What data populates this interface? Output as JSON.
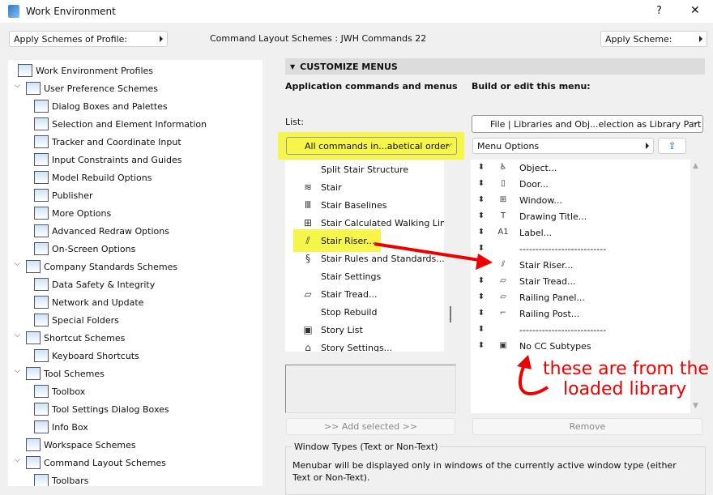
{
  "window": {
    "title": "Work Environment",
    "help": "?",
    "close": "✕"
  },
  "top": {
    "apply_profile": "Apply Schemes of Profile:",
    "layout_label": "Command Layout Schemes :",
    "layout_value": "JWH Commands 22",
    "apply_scheme": "Apply Scheme:"
  },
  "tree": [
    {
      "label": "Work Environment Profiles",
      "level": 0,
      "toggle": false
    },
    {
      "label": "User Preference Schemes",
      "level": 1,
      "toggle": true
    },
    {
      "label": "Dialog Boxes and Palettes",
      "level": 2
    },
    {
      "label": "Selection and Element Information",
      "level": 2
    },
    {
      "label": "Tracker and Coordinate Input",
      "level": 2
    },
    {
      "label": "Input Constraints and Guides",
      "level": 2
    },
    {
      "label": "Model Rebuild Options",
      "level": 2
    },
    {
      "label": "Publisher",
      "level": 2
    },
    {
      "label": "More Options",
      "level": 2
    },
    {
      "label": "Advanced Redraw Options",
      "level": 2
    },
    {
      "label": "On-Screen Options",
      "level": 2
    },
    {
      "label": "Company Standards Schemes",
      "level": 1,
      "toggle": true
    },
    {
      "label": "Data Safety & Integrity",
      "level": 2
    },
    {
      "label": "Network and Update",
      "level": 2
    },
    {
      "label": "Special Folders",
      "level": 2
    },
    {
      "label": "Shortcut Schemes",
      "level": 1,
      "toggle": true
    },
    {
      "label": "Keyboard Shortcuts",
      "level": 2
    },
    {
      "label": "Tool Schemes",
      "level": 1,
      "toggle": true
    },
    {
      "label": "Toolbox",
      "level": 2
    },
    {
      "label": "Tool Settings Dialog Boxes",
      "level": 2
    },
    {
      "label": "Info Box",
      "level": 2
    },
    {
      "label": "Workspace Schemes",
      "level": 1,
      "toggle": false
    },
    {
      "label": "Command Layout Schemes",
      "level": 1,
      "toggle": true
    },
    {
      "label": "Toolbars",
      "level": 2
    }
  ],
  "section": {
    "title": "CUSTOMIZE MENUS",
    "left_heading": "Application commands and menus",
    "right_heading": "Build or edit this menu:",
    "list_label": "List:"
  },
  "list_filter": "All commands in...abetical order",
  "commands": [
    {
      "label": "Split Stair Structure",
      "icon": ""
    },
    {
      "label": "Stair",
      "icon": "stair-icon"
    },
    {
      "label": "Stair Baselines",
      "icon": "stair-baselines-icon"
    },
    {
      "label": "Stair Calculated Walking Line",
      "icon": "walking-line-icon"
    },
    {
      "label": "Stair Riser...",
      "icon": "stair-riser-icon",
      "highlight": true
    },
    {
      "label": "Stair Rules and Standards...",
      "icon": "rules-icon"
    },
    {
      "label": "Stair Settings",
      "icon": ""
    },
    {
      "label": "Stair Tread...",
      "icon": "stair-tread-icon"
    },
    {
      "label": "Stop Rebuild",
      "icon": ""
    },
    {
      "label": "Story List",
      "icon": "story-list-icon"
    },
    {
      "label": "Story Settings...",
      "icon": "story-settings-icon"
    }
  ],
  "menu_select": "File | Libraries and Obj...election as Library Part",
  "menu_options": "Menu Options",
  "menu_items": [
    {
      "label": "Object...",
      "icon": "object-icon"
    },
    {
      "label": "Door...",
      "icon": "door-icon"
    },
    {
      "label": "Window...",
      "icon": "window-icon"
    },
    {
      "label": "Drawing Title...",
      "icon": "drawing-title-icon"
    },
    {
      "label": "Label...",
      "icon": "label-icon"
    },
    {
      "label": "---------------------------",
      "icon": ""
    },
    {
      "label": "Stair Riser...",
      "icon": "stair-riser-icon"
    },
    {
      "label": "Stair Tread...",
      "icon": "stair-tread-icon"
    },
    {
      "label": "Railing Panel...",
      "icon": "railing-panel-icon"
    },
    {
      "label": "Railing Post...",
      "icon": "railing-post-icon"
    },
    {
      "label": "---------------------------",
      "icon": ""
    },
    {
      "label": "No CC Subtypes",
      "icon": "subtypes-icon"
    }
  ],
  "add_selected": ">> Add selected >>",
  "remove": "Remove",
  "window_types": {
    "legend": "Window Types (Text or Non-Text)",
    "text": "Menubar will be displayed only in windows of the currently active window type (either Text or Non-Text)."
  },
  "annotation": {
    "line1": "these are from the",
    "line2": "loaded library",
    "color": "#ee0000"
  },
  "colors": {
    "highlight": "#f5f54a"
  }
}
